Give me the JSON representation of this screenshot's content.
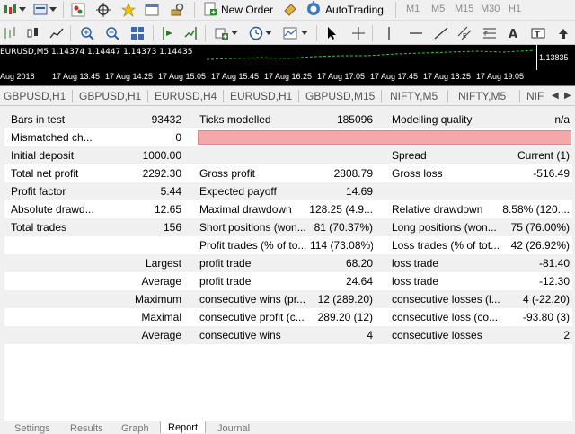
{
  "toolbar": {
    "new_order_label": "New Order",
    "autotrading_label": "AutoTrading",
    "timeframes": [
      "M1",
      "M5",
      "M15",
      "M30",
      "H1"
    ]
  },
  "chart": {
    "symbol_line": "EURUSD,M5  1.14374 1.14447 1.14373 1.14435",
    "price_label": "1.13835",
    "time_labels": [
      "Aug 2018",
      "17 Aug 13:45",
      "17 Aug 14:25",
      "17 Aug 15:05",
      "17 Aug 15:45",
      "17 Aug 16:25",
      "17 Aug 17:05",
      "17 Aug 17:45",
      "17 Aug 18:25",
      "17 Aug 19:05"
    ]
  },
  "chart_tabs": [
    "GBPUSD,H1",
    "GBPUSD,H1",
    "EURUSD,H4",
    "EURUSD,H1",
    "GBPUSD,M15",
    "NIFTY,M5",
    "NIFTY,M5",
    "NIF"
  ],
  "report": {
    "bars_in_test_label": "Bars in test",
    "bars_in_test_value": "93432",
    "ticks_modelled_label": "Ticks modelled",
    "ticks_modelled_value": "185096",
    "modelling_quality_label": "Modelling quality",
    "modelling_quality_value": "n/a",
    "mismatched_label": "Mismatched ch...",
    "mismatched_value": "0",
    "initial_deposit_label": "Initial deposit",
    "initial_deposit_value": "1000.00",
    "spread_label": "Spread",
    "spread_value": "Current (1)",
    "total_net_profit_label": "Total net profit",
    "total_net_profit_value": "2292.30",
    "gross_profit_label": "Gross profit",
    "gross_profit_value": "2808.79",
    "gross_loss_label": "Gross loss",
    "gross_loss_value": "-516.49",
    "profit_factor_label": "Profit factor",
    "profit_factor_value": "5.44",
    "expected_payoff_label": "Expected payoff",
    "expected_payoff_value": "14.69",
    "absolute_drawdown_label": "Absolute drawd...",
    "absolute_drawdown_value": "12.65",
    "maximal_drawdown_label": "Maximal drawdown",
    "maximal_drawdown_value": "128.25 (4.9...",
    "relative_drawdown_label": "Relative drawdown",
    "relative_drawdown_value": "8.58% (120....",
    "total_trades_label": "Total trades",
    "total_trades_value": "156",
    "short_positions_label": "Short positions (won...",
    "short_positions_value": "81 (70.37%)",
    "long_positions_label": "Long positions (won...",
    "long_positions_value": "75 (76.00%)",
    "profit_trades_label": "Profit trades (% of to...",
    "profit_trades_value": "114 (73.08%)",
    "loss_trades_label": "Loss trades (% of tot...",
    "loss_trades_value": "42 (26.92%)",
    "largest_label": "Largest",
    "largest_profit_label": "profit trade",
    "largest_profit_value": "68.20",
    "largest_loss_label": "loss trade",
    "largest_loss_value": "-81.40",
    "average_label": "Average",
    "average_profit_label": "profit trade",
    "average_profit_value": "24.64",
    "average_loss_label": "loss trade",
    "average_loss_value": "-12.30",
    "maximum_label": "Maximum",
    "max_cons_wins_label": "consecutive wins (pr...",
    "max_cons_wins_value": "12 (289.20)",
    "max_cons_losses_label": "consecutive losses (l...",
    "max_cons_losses_value": "4 (-22.20)",
    "maximal_label": "Maximal",
    "maximal_cons_profit_label": "consecutive profit (c...",
    "maximal_cons_profit_value": "289.20 (12)",
    "maximal_cons_loss_label": "consecutive loss (co...",
    "maximal_cons_loss_value": "-93.80 (3)",
    "average2_label": "Average",
    "avg_cons_wins_label": "consecutive wins",
    "avg_cons_wins_value": "4",
    "avg_cons_losses_label": "consecutive losses",
    "avg_cons_losses_value": "2"
  },
  "bottom_tabs": [
    "Settings",
    "Results",
    "Graph",
    "Report",
    "Journal"
  ],
  "active_bottom_tab": "Report"
}
